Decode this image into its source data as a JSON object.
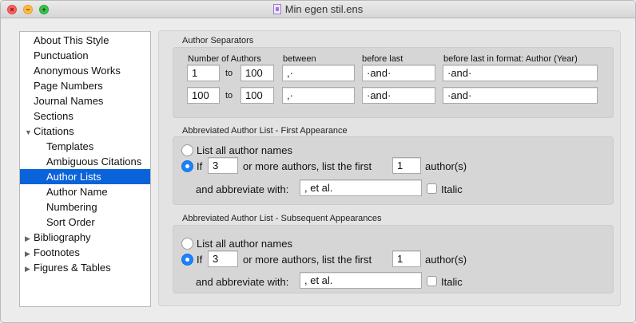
{
  "window": {
    "title": "Min egen stil.ens"
  },
  "sidebar": {
    "items": [
      {
        "label": "About This Style",
        "arrow": ""
      },
      {
        "label": "Punctuation",
        "arrow": ""
      },
      {
        "label": "Anonymous Works",
        "arrow": ""
      },
      {
        "label": "Page Numbers",
        "arrow": ""
      },
      {
        "label": "Journal Names",
        "arrow": ""
      },
      {
        "label": "Sections",
        "arrow": ""
      },
      {
        "label": "Citations",
        "arrow": "▼"
      },
      {
        "label": "Templates",
        "arrow": ""
      },
      {
        "label": "Ambiguous Citations",
        "arrow": ""
      },
      {
        "label": "Author Lists",
        "arrow": ""
      },
      {
        "label": "Author Name",
        "arrow": ""
      },
      {
        "label": "Numbering",
        "arrow": ""
      },
      {
        "label": "Sort Order",
        "arrow": ""
      },
      {
        "label": "Bibliography",
        "arrow": "▶"
      },
      {
        "label": "Footnotes",
        "arrow": "▶"
      },
      {
        "label": "Figures & Tables",
        "arrow": "▶"
      }
    ],
    "selected": "Author Lists"
  },
  "separators": {
    "title": "Author Separators",
    "col_num_authors": "Number of Authors",
    "col_between": "between",
    "col_before_last": "before last",
    "col_before_last_format": "before last in format: Author (Year)",
    "to_label": "to",
    "rows": [
      {
        "from": "1",
        "to": "100",
        "between": ",·",
        "before_last": "·and·",
        "before_last_format": "·and·"
      },
      {
        "from": "100",
        "to": "100",
        "between": ",·",
        "before_last": "·and·",
        "before_last_format": "·and·"
      }
    ]
  },
  "first": {
    "title": "Abbreviated Author List - First Appearance",
    "list_all_label": "List all author names",
    "if_label": "If",
    "count": "3",
    "middle_label": "or more authors, list the first",
    "first_n": "1",
    "authors_label": "author(s)",
    "abbrev_label": "and abbreviate with:",
    "abbrev_value": ", et al.",
    "italic_label": "Italic"
  },
  "subsequent": {
    "title": "Abbreviated Author List - Subsequent Appearances",
    "list_all_label": "List all author names",
    "if_label": "If",
    "count": "3",
    "middle_label": "or more authors, list the first",
    "first_n": "1",
    "authors_label": "author(s)",
    "abbrev_label": "and abbreviate with:",
    "abbrev_value": ", et al.",
    "italic_label": "Italic"
  }
}
